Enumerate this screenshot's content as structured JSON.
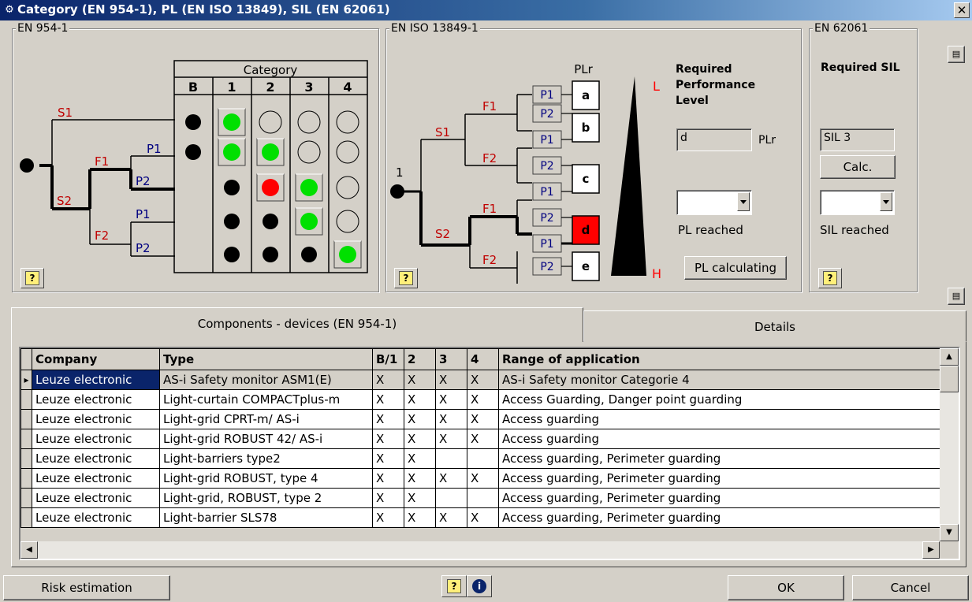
{
  "window": {
    "title": "Category (EN 954-1), PL (EN ISO 13849), SIL (EN 62061)",
    "icon": "gear-icon",
    "close": "✕"
  },
  "en954": {
    "legend": "EN 954-1",
    "header": "Category",
    "columns": [
      "B",
      "1",
      "2",
      "3",
      "4"
    ],
    "tree": {
      "s1": "S1",
      "s2": "S2",
      "f1": "F1",
      "f2": "F2",
      "p1a": "P1",
      "p2a": "P2",
      "p1b": "P1",
      "p2b": "P2"
    }
  },
  "pl": {
    "legend": "EN ISO 13849-1",
    "plr_header": "PLr",
    "start_label": "1",
    "tree": {
      "s1": "S1",
      "s2": "S2",
      "f1a": "F1",
      "f2a": "F2",
      "f1b": "F1",
      "f2b": "F2"
    },
    "p_labels": [
      "P1",
      "P2",
      "P1",
      "P2",
      "P1",
      "P2",
      "P1",
      "P2"
    ],
    "levels": [
      "a",
      "b",
      "c",
      "d",
      "e"
    ],
    "selected_level": "d",
    "low": "L",
    "high": "H",
    "required_title": "Required Performance Level",
    "required_value": "d",
    "required_unit": "PLr",
    "reached_label": "PL reached",
    "calc_button": "PL calculating"
  },
  "sil": {
    "legend": "EN 62061",
    "required_title": "Required SIL",
    "value": "SIL 3",
    "calc_button": "Calc.",
    "reached_label": "SIL reached"
  },
  "tabs": [
    "Components - devices (EN 954-1)",
    "Details"
  ],
  "table": {
    "columns": [
      "Company",
      "Type",
      "B/1",
      "2",
      "3",
      "4",
      "Range of application"
    ],
    "rows": [
      [
        "Leuze electronic",
        "AS-i Safety monitor ASM1(E)",
        "X",
        "X",
        "X",
        "X",
        "AS-i Safety monitor Categorie 4"
      ],
      [
        "Leuze electronic",
        "Light-curtain COMPACTplus-m",
        "X",
        "X",
        "X",
        "X",
        "Access Guarding, Danger point guarding"
      ],
      [
        "Leuze electronic",
        "Light-grid CPRT-m/ AS-i",
        "X",
        "X",
        "X",
        "X",
        "Access guarding"
      ],
      [
        "Leuze electronic",
        "Light-grid ROBUST 42/ AS-i",
        "X",
        "X",
        "X",
        "X",
        "Access guarding"
      ],
      [
        "Leuze electronic",
        "Light-barriers type2",
        "X",
        "X",
        "",
        "",
        "Access guarding, Perimeter guarding"
      ],
      [
        "Leuze electronic",
        "Light-grid ROBUST, type 4",
        "X",
        "X",
        "X",
        "X",
        "Access guarding, Perimeter guarding"
      ],
      [
        "Leuze electronic",
        "Light-grid, ROBUST, type 2",
        "X",
        "X",
        "",
        "",
        "Access guarding, Perimeter guarding"
      ],
      [
        "Leuze electronic",
        "Light-barrier SLS78",
        "X",
        "X",
        "X",
        "X",
        "Access guarding, Perimeter guarding"
      ]
    ]
  },
  "footer": {
    "risk": "Risk estimation",
    "ok": "OK",
    "cancel": "Cancel"
  },
  "colors": {
    "green": "#00e000",
    "red": "#ff0000",
    "param_red": "#c00000",
    "param_blue": "#000080"
  }
}
